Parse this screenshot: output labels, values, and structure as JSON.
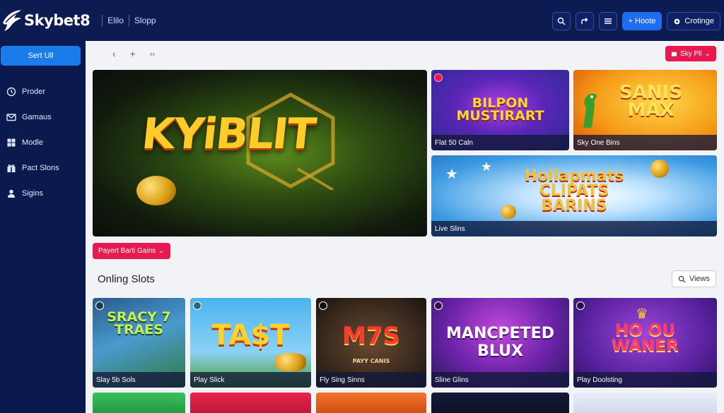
{
  "brand": {
    "name": "Skybet8"
  },
  "topnav": [
    "Elilo",
    "Slopp"
  ],
  "top_actions": {
    "home_label": "+ Hoote",
    "crotinge_label": "Crotinge"
  },
  "sidebar": {
    "cta_label": "Sert Ull",
    "items": [
      {
        "label": "Proder",
        "icon": "clock-icon"
      },
      {
        "label": "Gamaus",
        "icon": "mail-icon"
      },
      {
        "label": "Modle",
        "icon": "grid-icon"
      },
      {
        "label": "Pact Slons",
        "icon": "gift-icon"
      },
      {
        "label": "Sigins",
        "icon": "user-icon"
      }
    ]
  },
  "main": {
    "stay_button": "Sky Pll",
    "hero": {
      "title": "KYiBLIT"
    },
    "featured": [
      {
        "title": "BILPON MUSTIRART",
        "caption": "Flat 50 Caln"
      },
      {
        "title": "SANIS MAX",
        "caption": "Sky One Bins"
      },
      {
        "title": "Hollapmats CLIPATS BARINS",
        "caption": "Live Slins"
      }
    ],
    "payout_button": "Payert Barti Gains",
    "section_title": "Onling Slots",
    "views_button": "Views",
    "slots": [
      {
        "title": "SRACY 7 TRAES",
        "caption": "Slay 5b Sols"
      },
      {
        "title": "TA$T",
        "caption": "Play Slick"
      },
      {
        "title": "M7S",
        "caption": "Fly Sing Sinns",
        "subtitle": "PAYY CANIS"
      },
      {
        "title": "MANCPETED BLUX",
        "caption": "Sline Glins"
      },
      {
        "title": "HO OU WANER",
        "caption": "Play Doolsting"
      }
    ]
  },
  "colors": {
    "navy": "#0b1a4e",
    "accent_blue": "#1a7bea",
    "accent_pink": "#e8194f"
  }
}
